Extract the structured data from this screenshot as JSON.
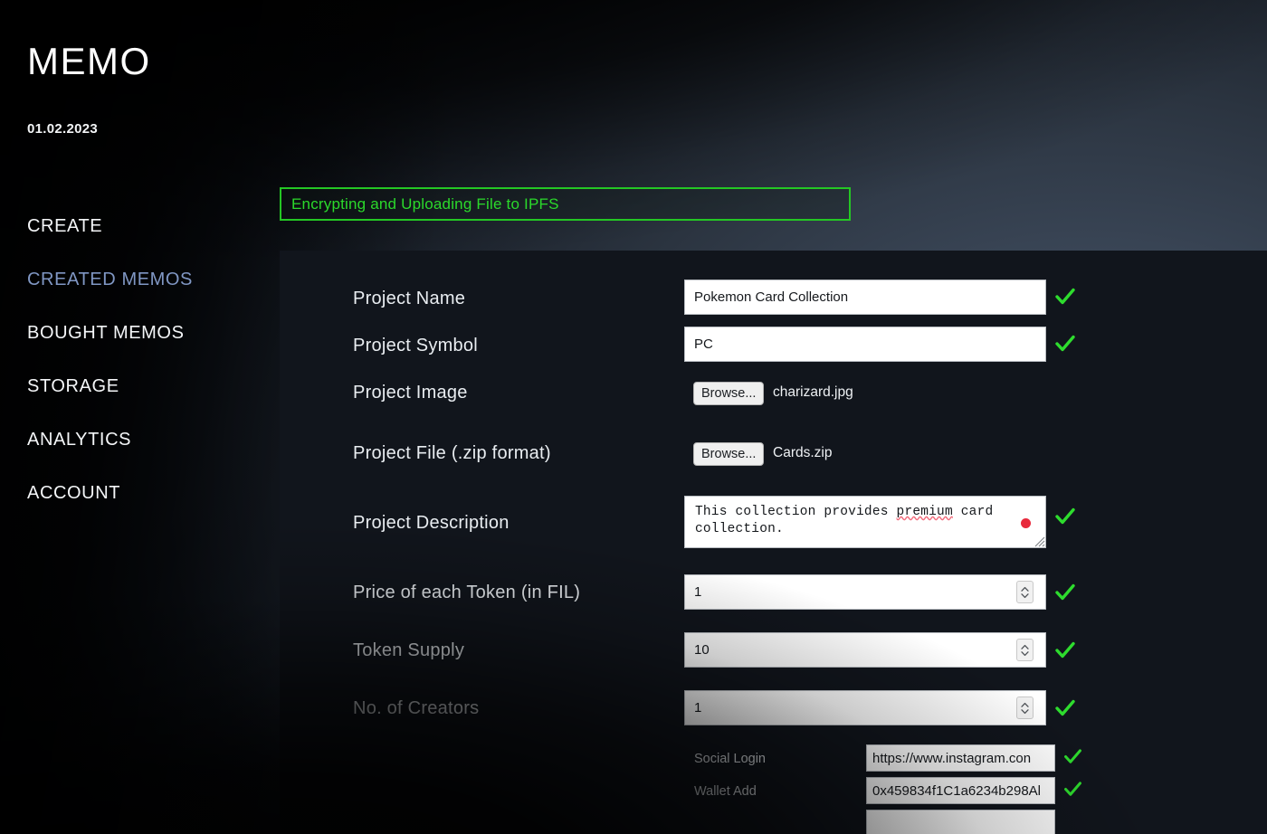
{
  "app": {
    "title": "MEMO",
    "date": "01.02.2023"
  },
  "sidebar": {
    "items": [
      {
        "label": "CREATE",
        "active": false
      },
      {
        "label": "CREATED MEMOS",
        "active": true
      },
      {
        "label": "BOUGHT MEMOS",
        "active": false
      },
      {
        "label": "STORAGE",
        "active": false
      },
      {
        "label": "ANALYTICS",
        "active": false
      },
      {
        "label": "ACCOUNT",
        "active": false
      }
    ],
    "active_color": "#8097c4"
  },
  "status": {
    "message": "Encrypting and Uploading File to IPFS",
    "color": "#2bd92b",
    "border_color": "#24c724"
  },
  "form": {
    "fields": {
      "project_name": {
        "label": "Project Name",
        "value": "Pokemon Card Collection",
        "valid": true
      },
      "project_symbol": {
        "label": "Project Symbol",
        "value": "PC",
        "valid": true
      },
      "project_image": {
        "label": "Project Image",
        "browse_label": "Browse...",
        "filename": "charizard.jpg"
      },
      "project_file": {
        "label": "Project File (.zip format)",
        "browse_label": "Browse...",
        "filename": "Cards.zip"
      },
      "project_description": {
        "label": "Project Description",
        "value_part1": "This collection provides ",
        "value_misspelled": "premium",
        "value_part2": " card collection.",
        "valid": true
      },
      "token_price": {
        "label": "Price of each Token (in FIL)",
        "value": "1",
        "valid": true
      },
      "token_supply": {
        "label": "Token Supply",
        "value": "10",
        "valid": true
      },
      "creators": {
        "label": "No. of Creators",
        "value": "1",
        "valid": true
      },
      "social_login": {
        "label": "Social Login",
        "value": "https://www.instagram.con",
        "valid": true
      },
      "wallet_add": {
        "label": "Wallet Add",
        "value": "0x459834f1C1a6234b298Al",
        "valid": true
      }
    },
    "check_color": "#2edc2e"
  }
}
